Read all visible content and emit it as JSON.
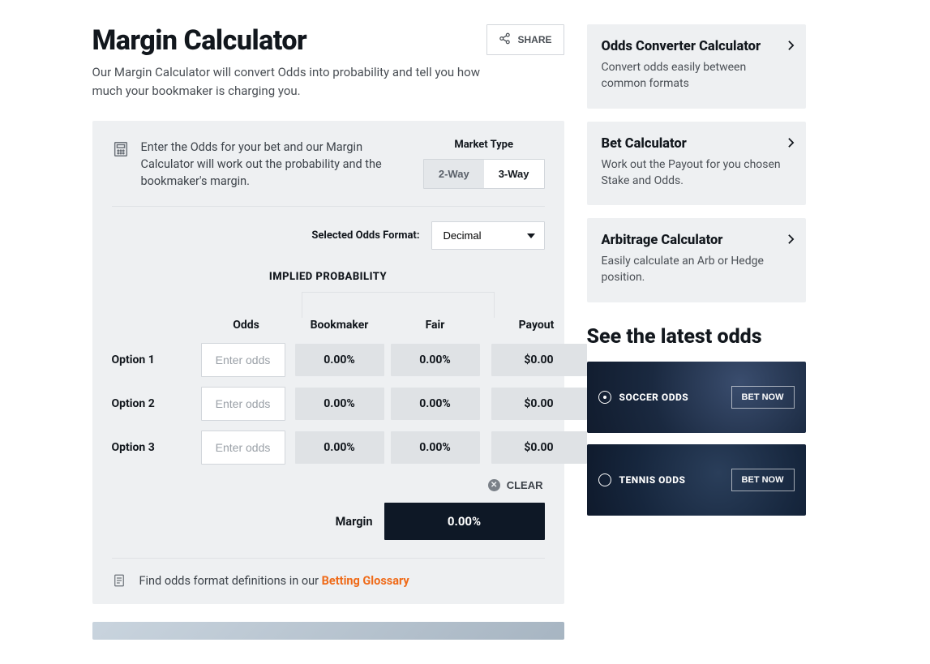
{
  "header": {
    "title": "Margin Calculator",
    "share_label": "SHARE",
    "description": "Our Margin Calculator will convert Odds into probability and tell you how much your bookmaker is charging you."
  },
  "panel": {
    "instructions": "Enter the Odds for your bet and our Margin Calculator will work out the probability and the bookmaker's margin.",
    "market_type_label": "Market Type",
    "market_type_options": {
      "two": "2-Way",
      "three": "3-Way"
    },
    "market_type_selected": "3-Way",
    "format_label": "Selected Odds Format:",
    "format_selected": "Decimal",
    "implied_label": "IMPLIED PROBABILITY",
    "cols": {
      "odds": "Odds",
      "bookmaker": "Bookmaker",
      "fair": "Fair",
      "payout": "Payout"
    },
    "rows": [
      {
        "label": "Option 1",
        "odds_placeholder": "Enter odds",
        "bookmaker": "0.00%",
        "fair": "0.00%",
        "payout": "$0.00"
      },
      {
        "label": "Option 2",
        "odds_placeholder": "Enter odds",
        "bookmaker": "0.00%",
        "fair": "0.00%",
        "payout": "$0.00"
      },
      {
        "label": "Option 3",
        "odds_placeholder": "Enter odds",
        "bookmaker": "0.00%",
        "fair": "0.00%",
        "payout": "$0.00"
      }
    ],
    "clear_label": "CLEAR",
    "margin_label": "Margin",
    "margin_value": "0.00%",
    "glossary_prefix": "Find odds format definitions in our ",
    "glossary_link": "Betting Glossary"
  },
  "sidebar": {
    "cards": [
      {
        "title": "Odds Converter Calculator",
        "desc": "Convert odds easily between common formats"
      },
      {
        "title": "Bet Calculator",
        "desc": "Work out the Payout for you chosen Stake and Odds."
      },
      {
        "title": "Arbitrage Calculator",
        "desc": "Easily calculate an Arb or Hedge position."
      }
    ],
    "latest_heading": "See the latest odds",
    "promos": [
      {
        "label": "SOCCER ODDS",
        "cta": "BET NOW",
        "kind": "soccer"
      },
      {
        "label": "TENNIS ODDS",
        "cta": "BET NOW",
        "kind": "tennis"
      }
    ]
  }
}
